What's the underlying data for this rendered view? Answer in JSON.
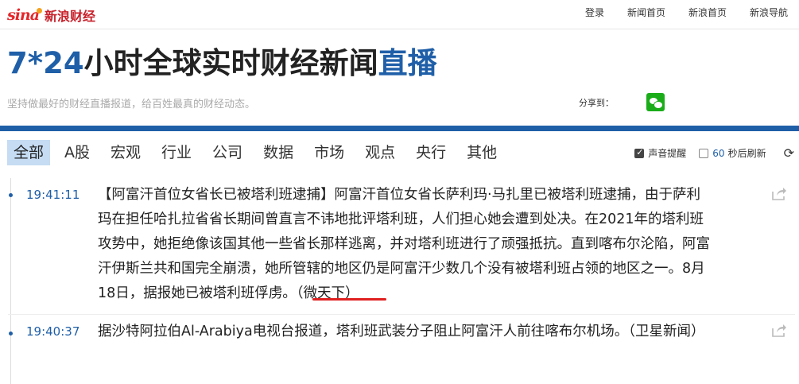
{
  "brand": {
    "sina": "sina",
    "name": "新浪财经"
  },
  "toplinks": [
    "登录",
    "新闻首页",
    "新浪首页",
    "新浪导航"
  ],
  "hero": {
    "title_prefix": "7*24",
    "title_main": "小时全球实时财经新闻",
    "title_suffix": "直播",
    "subtitle": "坚持做最好的财经直播报道，给百姓最真的财经动态。",
    "share_label": "分享到："
  },
  "nav": {
    "tabs": [
      "全部",
      "A股",
      "宏观",
      "行业",
      "公司",
      "数据",
      "市场",
      "观点",
      "央行",
      "其他"
    ],
    "active": "全部",
    "sound_label": "声音提醒",
    "refresh_seconds": "60",
    "refresh_label": "秒后刷新"
  },
  "feed": [
    {
      "time": "19:41:11",
      "text": "【阿富汗首位女省长已被塔利班逮捕】阿富汗首位女省长萨利玛·马扎里已被塔利班逮捕，由于萨利玛在担任哈扎拉省省长期间曾直言不讳地批评塔利班，人们担心她会遭到处决。在2021年的塔利班攻势中，她拒绝像该国其他一些省长那样逃离，并对塔利班进行了顽强抵抗。直到喀布尔沦陷，阿富汗伊斯兰共和国完全崩溃，她所管辖的地区仍是阿富汗少数几个没有被塔利班占领的地区之一。8月18日，据报她已被塔利班俘虏。",
      "source": "（微天下）"
    },
    {
      "time": "19:40:37",
      "text": "据沙特阿拉伯Al-Arabiya电视台报道，塔利班武装分子阻止阿富汗人前往喀布尔机场。",
      "source": "（卫星新闻）"
    }
  ],
  "colors": {
    "accent": "#1f5fa8",
    "brand_red": "#e4272b",
    "active_tab_bg": "#c5dcf3",
    "wechat": "#1aad19"
  },
  "icons": [
    "wechat-icon",
    "refresh-icon",
    "share-icon"
  ]
}
